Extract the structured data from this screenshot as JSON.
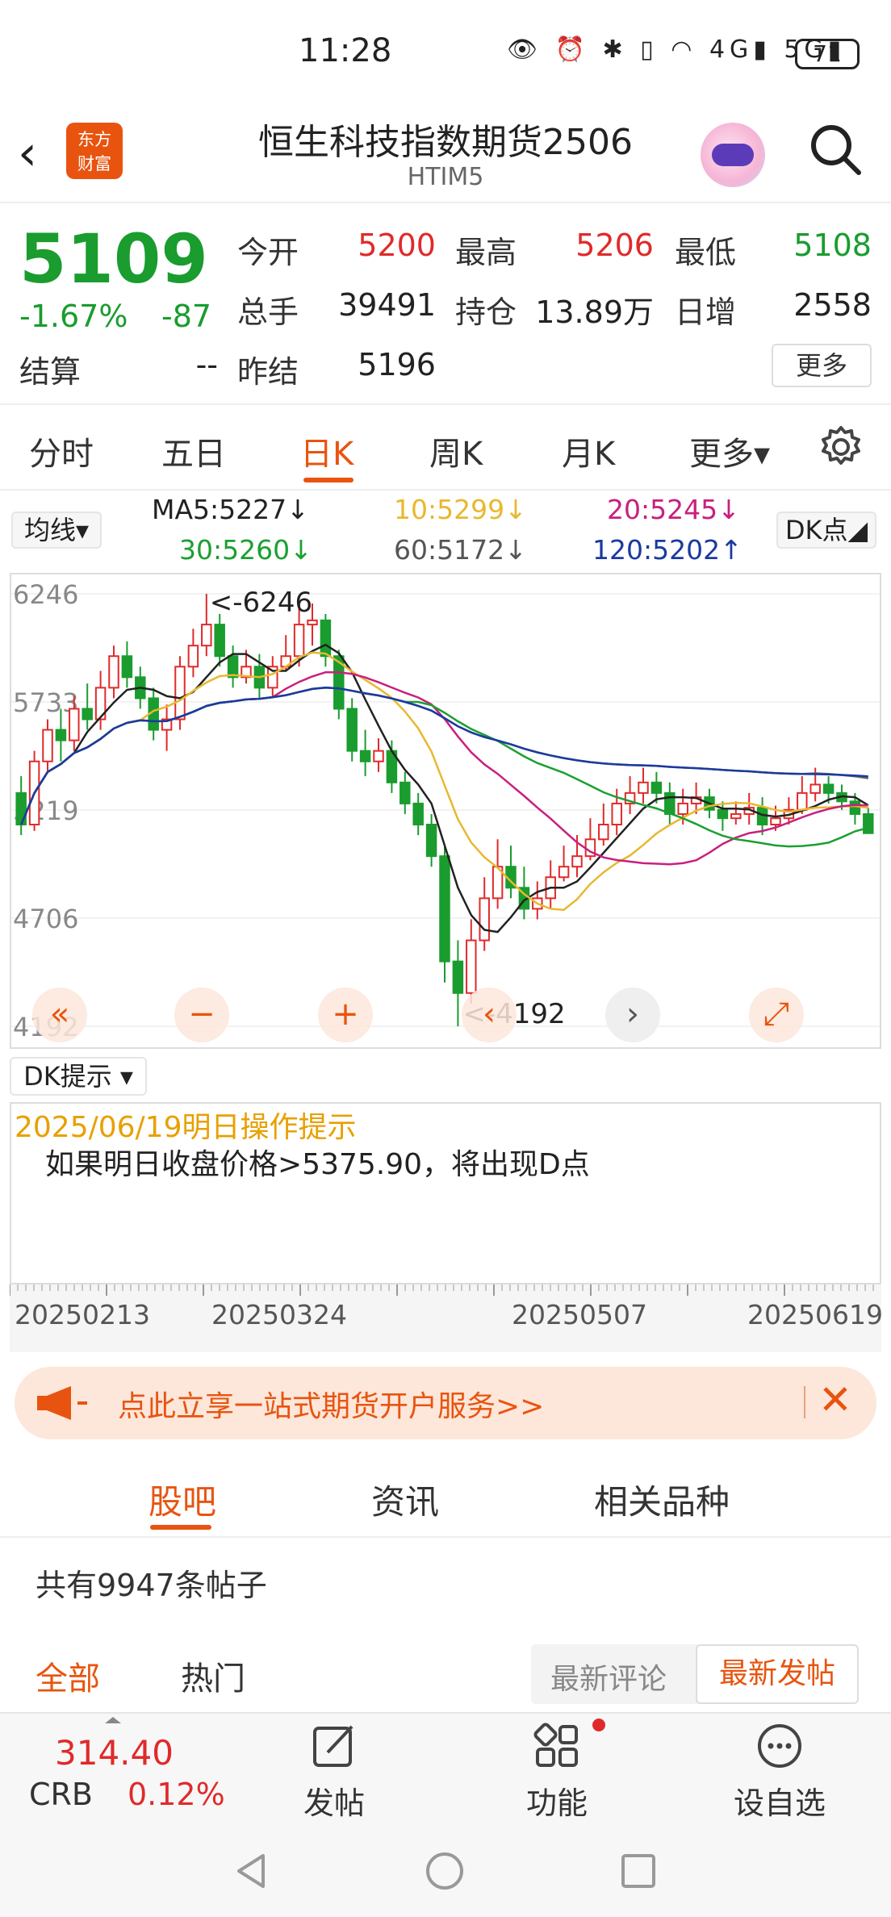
{
  "status": {
    "time": "11:28",
    "icons_text": "👁 ⏰ ✱ ▯ ◠ 4G▮ 5G▮",
    "battery": "71"
  },
  "header": {
    "logo": "东方\n财富",
    "title": "恒生科技指数期货2506",
    "subtitle": "HTIM5"
  },
  "quote": {
    "price": "5109",
    "pct": "-1.67%",
    "chg": "-87",
    "labels": {
      "open": "今开",
      "high": "最高",
      "low": "最低",
      "volume": "总手",
      "oi": "持仓",
      "daily_inc": "日增",
      "settle": "结算",
      "prev_settle": "昨结"
    },
    "values": {
      "open": "5200",
      "high": "5206",
      "low": "5108",
      "volume": "39491",
      "oi": "13.89万",
      "daily_inc": "2558",
      "settle": "--",
      "prev_settle": "5196"
    },
    "more": "更多"
  },
  "tabs": [
    "分时",
    "五日",
    "日K",
    "周K",
    "月K",
    "更多▾"
  ],
  "ma": {
    "select": "均线▾",
    "ma5": "MA5:5227↓",
    "ma10": "10:5299↓",
    "ma20": "20:5245↓",
    "ma30": "30:5260↓",
    "ma60": "60:5172↓",
    "ma120": "120:5202↑",
    "dk": "DK点◢",
    "colors": {
      "ma5": "#222222",
      "ma10": "#e8b830",
      "ma20": "#c8207e",
      "ma30": "#1aa030",
      "ma60": "#666666",
      "ma120": "#1a3aa0"
    }
  },
  "chart_data": {
    "type": "candlestick",
    "y_ticks": [
      "6246",
      "5733",
      "5219",
      "4706",
      "4192"
    ],
    "ylim": [
      4192,
      6246
    ],
    "high_annotation": "<-6246",
    "low_annotation": "<-4192",
    "x_ticks": [
      "20250213",
      "20250324",
      "20250507",
      "20250619"
    ],
    "candles": [
      [
        5300,
        5150,
        5380,
        5100
      ],
      [
        5150,
        5450,
        5500,
        5120
      ],
      [
        5450,
        5600,
        5650,
        5400
      ],
      [
        5600,
        5550,
        5700,
        5450
      ],
      [
        5550,
        5700,
        5760,
        5500
      ],
      [
        5700,
        5650,
        5820,
        5600
      ],
      [
        5650,
        5800,
        5880,
        5600
      ],
      [
        5800,
        5950,
        6000,
        5750
      ],
      [
        5950,
        5850,
        6020,
        5800
      ],
      [
        5850,
        5750,
        5900,
        5700
      ],
      [
        5750,
        5600,
        5800,
        5550
      ],
      [
        5600,
        5650,
        5720,
        5500
      ],
      [
        5650,
        5900,
        5950,
        5600
      ],
      [
        5900,
        6000,
        6080,
        5850
      ],
      [
        6000,
        6100,
        6246,
        5950
      ],
      [
        6100,
        5950,
        6150,
        5900
      ],
      [
        5950,
        5850,
        6000,
        5800
      ],
      [
        5850,
        5900,
        5980,
        5820
      ],
      [
        5900,
        5800,
        5960,
        5750
      ],
      [
        5800,
        5900,
        5950,
        5750
      ],
      [
        5900,
        5950,
        6050,
        5880
      ],
      [
        5950,
        6100,
        6180,
        5900
      ],
      [
        6100,
        6120,
        6200,
        6000
      ],
      [
        6120,
        5950,
        6150,
        5900
      ],
      [
        5950,
        5700,
        5980,
        5650
      ],
      [
        5700,
        5500,
        5750,
        5450
      ],
      [
        5500,
        5450,
        5600,
        5380
      ],
      [
        5450,
        5500,
        5560,
        5400
      ],
      [
        5500,
        5350,
        5550,
        5300
      ],
      [
        5350,
        5250,
        5400,
        5200
      ],
      [
        5250,
        5150,
        5300,
        5100
      ],
      [
        5150,
        5000,
        5200,
        4950
      ],
      [
        5000,
        4500,
        5050,
        4400
      ],
      [
        4500,
        4350,
        4600,
        4192
      ],
      [
        4350,
        4600,
        4700,
        4300
      ],
      [
        4600,
        4800,
        4900,
        4550
      ],
      [
        4800,
        4950,
        5080,
        4750
      ],
      [
        4950,
        4850,
        5050,
        4800
      ],
      [
        4850,
        4750,
        4950,
        4700
      ],
      [
        4750,
        4800,
        4880,
        4700
      ],
      [
        4800,
        4900,
        4980,
        4750
      ],
      [
        4900,
        4950,
        5050,
        4880
      ],
      [
        4950,
        5000,
        5100,
        4900
      ],
      [
        5000,
        5080,
        5180,
        4980
      ],
      [
        5080,
        5150,
        5250,
        5050
      ],
      [
        5150,
        5250,
        5320,
        5100
      ],
      [
        5250,
        5300,
        5380,
        5200
      ],
      [
        5300,
        5350,
        5420,
        5250
      ],
      [
        5350,
        5300,
        5400,
        5250
      ],
      [
        5300,
        5200,
        5350,
        5150
      ],
      [
        5200,
        5250,
        5320,
        5150
      ],
      [
        5250,
        5280,
        5350,
        5200
      ],
      [
        5280,
        5220,
        5320,
        5180
      ],
      [
        5220,
        5180,
        5260,
        5120
      ],
      [
        5180,
        5200,
        5260,
        5150
      ],
      [
        5200,
        5230,
        5300,
        5150
      ],
      [
        5230,
        5150,
        5280,
        5100
      ],
      [
        5150,
        5180,
        5240,
        5120
      ],
      [
        5180,
        5220,
        5280,
        5150
      ],
      [
        5220,
        5300,
        5380,
        5200
      ],
      [
        5300,
        5340,
        5420,
        5260
      ],
      [
        5340,
        5300,
        5380,
        5250
      ],
      [
        5300,
        5260,
        5340,
        5220
      ],
      [
        5260,
        5200,
        5300,
        5150
      ],
      [
        5200,
        5109,
        5230,
        5108
      ]
    ]
  },
  "dk": {
    "select": "DK提示 ▾",
    "date": "2025/06/19明日操作提示",
    "text": "如果明日收盘价格>5375.90，将出现D点"
  },
  "banner": {
    "text": "点此立享一站式期货开户服务>>",
    "close": "✕"
  },
  "bottom_tabs": [
    "股吧",
    "资讯",
    "相关品种"
  ],
  "posts": {
    "count_text": "共有9947条帖子",
    "filter_all": "全部",
    "filter_hot": "热门",
    "sort_latest_comment": "最新评论",
    "sort_latest_post": "最新发帖"
  },
  "tabbar": {
    "crb_price": "314.40",
    "crb_label": "CRB",
    "crb_pct": "0.12%",
    "post": "发帖",
    "func": "功能",
    "fav": "设自选"
  }
}
